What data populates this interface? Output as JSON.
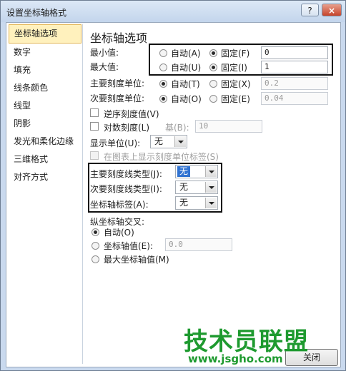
{
  "window": {
    "title": "设置坐标轴格式",
    "help_label": "?",
    "close_label": "×"
  },
  "nav": {
    "items": [
      {
        "label": "坐标轴选项",
        "selected": true
      },
      {
        "label": "数字"
      },
      {
        "label": "填充"
      },
      {
        "label": "线条颜色"
      },
      {
        "label": "线型"
      },
      {
        "label": "阴影"
      },
      {
        "label": "发光和柔化边缘"
      },
      {
        "label": "三维格式"
      },
      {
        "label": "对齐方式"
      }
    ]
  },
  "axis": {
    "heading": "坐标轴选项",
    "min": {
      "label": "最小值:",
      "auto": "自动(A)",
      "fixed": "固定(F)",
      "value": "0"
    },
    "max": {
      "label": "最大值:",
      "auto": "自动(U)",
      "fixed": "固定(I)",
      "value": "1"
    },
    "major_unit": {
      "label": "主要刻度单位:",
      "auto": "自动(T)",
      "fixed": "固定(X)",
      "value": "0.2"
    },
    "minor_unit": {
      "label": "次要刻度单位:",
      "auto": "自动(O)",
      "fixed": "固定(E)",
      "value": "0.04"
    },
    "reverse": {
      "label": "逆序刻度值(V)"
    },
    "log": {
      "label": "对数刻度(L)",
      "base_label": "基(B):",
      "base_value": "10"
    },
    "display_unit": {
      "label": "显示单位(U):",
      "value": "无"
    },
    "show_unit_label": {
      "label": "在图表上显示刻度单位标签(S)"
    },
    "major_tick": {
      "label": "主要刻度线类型(J):",
      "value": "无"
    },
    "minor_tick": {
      "label": "次要刻度线类型(I):",
      "value": "无"
    },
    "tick_label": {
      "label": "坐标轴标签(A):",
      "value": "无"
    },
    "cross": {
      "label": "纵坐标轴交叉:",
      "auto": "自动(O)",
      "value_label": "坐标轴值(E):",
      "value": "0.0",
      "max_label": "最大坐标轴值(M)"
    }
  },
  "watermark": {
    "text": "技术员联盟",
    "url": "www.jsgho.com"
  },
  "footer": {
    "close_label": "关闭"
  }
}
